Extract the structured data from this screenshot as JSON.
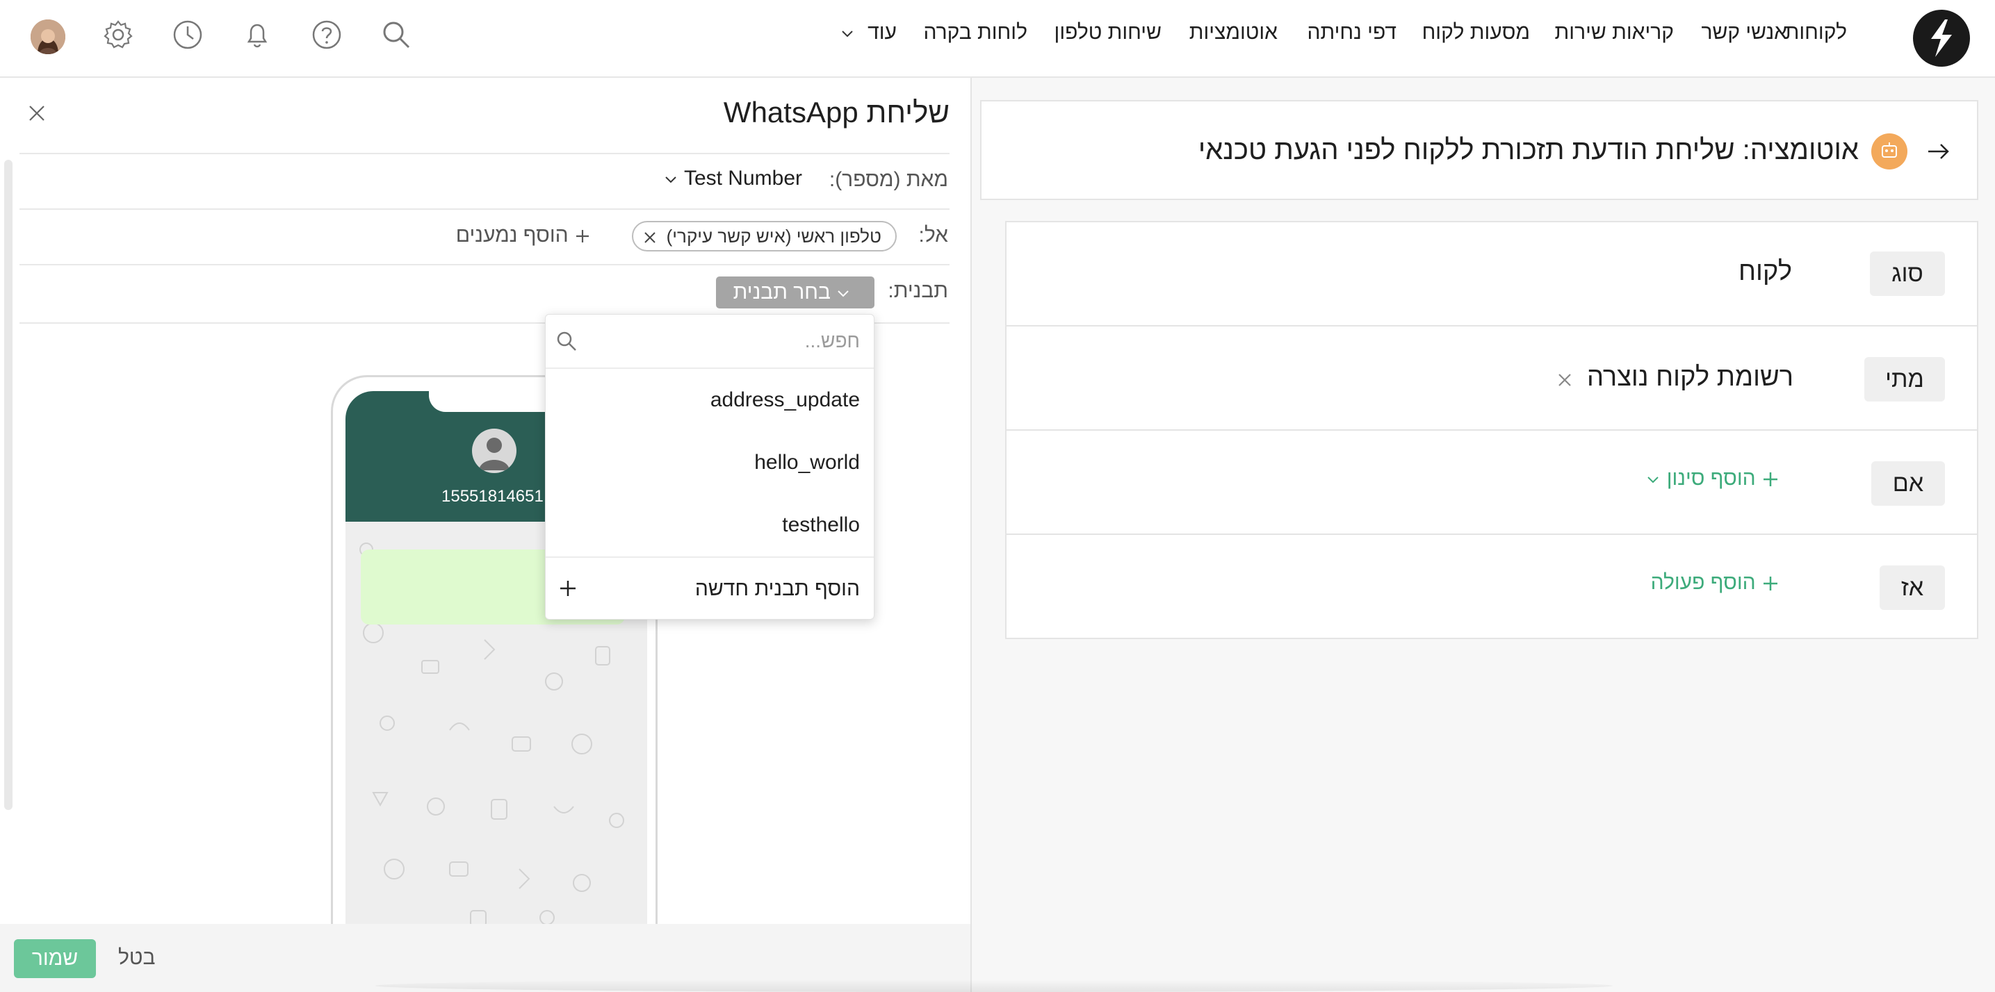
{
  "nav": {
    "items": [
      "לקוחות",
      "אנשי קשר",
      "קריאות שירות",
      "מסעות לקוח",
      "דפי נחיתה",
      "אוטומציות",
      "שיחות טלפון",
      "לוחות בקרה"
    ],
    "more_label": "עוד"
  },
  "automation": {
    "title": "אוטומציה: שליחת הודעת תזכורת ללקוח לפני הגעת טכנאי",
    "type_tag": "סוג",
    "type_value": "לקוח",
    "when_tag": "מתי",
    "when_value": "רשומת לקוח נוצרה",
    "if_tag": "אם",
    "if_action": "הוסף סינון",
    "then_tag": "אז",
    "then_action": "הוסף פעולה"
  },
  "whatsapp": {
    "title": "שליחת WhatsApp",
    "from_label": "מאת (מספר):",
    "from_value": "Test Number",
    "to_label": "אל:",
    "to_chip": "טלפון ראשי (איש קשר עיקרי)",
    "add_recipients": "הוסף נמענים",
    "template_label": "תבנית:",
    "template_button": "בחר תבנית",
    "phone_number": "15551814651"
  },
  "template_dropdown": {
    "search_placeholder": "חפש...",
    "options": [
      "address_update",
      "hello_world",
      "testhello"
    ],
    "add_new": "הוסף תבנית חדשה"
  },
  "footer": {
    "save_label": "שמור",
    "cancel_label": "בטל"
  },
  "colors": {
    "accent_green": "#3dab7b",
    "save_button": "#6cc79a",
    "whatsapp_header": "#2b5e55",
    "automation_icon": "#f3a95b",
    "template_button": "#a5a5a5"
  }
}
